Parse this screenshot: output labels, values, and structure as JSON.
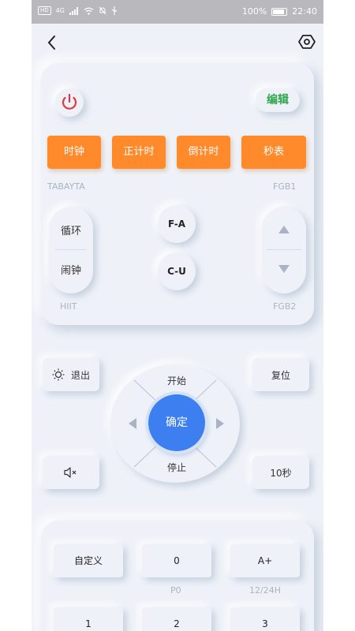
{
  "status_bar": {
    "left_tags": [
      "HD",
      "4G"
    ],
    "battery": "100%",
    "time": "22:40"
  },
  "header": {
    "back_icon": "chevron-left-icon",
    "settings_icon": "hexagon-settings-icon"
  },
  "panel": {
    "power_icon": "power-icon",
    "power_color": "#e0393e",
    "edit_label": "编辑",
    "edit_color": "#2fa64a",
    "modes": [
      "时钟",
      "正计时",
      "倒计时",
      "秒表"
    ],
    "mode_color": "#ff8a2b",
    "label_tabayta": "TABAYTA",
    "label_fgb1": "FGB1",
    "loop_label": "循环",
    "alarm_label": "闹钟",
    "fa_label": "F-A",
    "cu_label": "C-U",
    "label_hiit": "HIIT",
    "label_fgb2": "FGB2"
  },
  "controls": {
    "exit_label": "退出",
    "brightness_icon": "sun-icon",
    "reset_label": "复位",
    "start_label": "开始",
    "ok_label": "确定",
    "stop_label": "停止",
    "mute_icon": "speaker-mute-icon",
    "ten_sec_label": "10秒",
    "accent": "#3d7ff0"
  },
  "keypad": {
    "row1": [
      "自定义",
      "0",
      "A+"
    ],
    "sub_p0": "P0",
    "sub_1224": "12/24H",
    "row2": [
      "1",
      "2",
      "3"
    ]
  }
}
